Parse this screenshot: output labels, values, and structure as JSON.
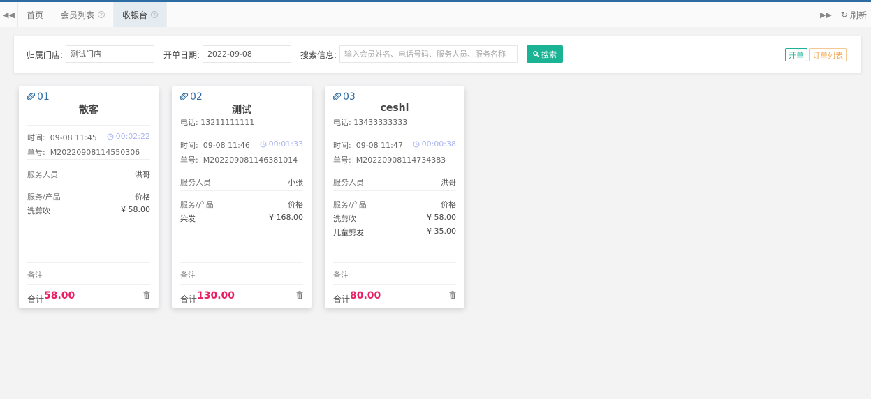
{
  "tabs": [
    {
      "label": "首页",
      "closable": false,
      "active": false
    },
    {
      "label": "会员列表",
      "closable": true,
      "active": false
    },
    {
      "label": "收银台",
      "closable": true,
      "active": true
    }
  ],
  "toolbar": {
    "refresh_label": "刷新"
  },
  "search": {
    "store_label": "归属门店:",
    "store_value": "测试门店",
    "date_label": "开单日期:",
    "date_value": "2022-09-08",
    "info_label": "搜索信息:",
    "info_placeholder": "输入会员姓名、电话号码、服务人员、服务名称",
    "search_button": "搜索",
    "open_button": "开单",
    "orders_button": "订单列表"
  },
  "labels": {
    "time": "时间:",
    "order_no": "单号:",
    "staff": "服务人员",
    "service": "服务/产品",
    "price": "价格",
    "remark": "备注",
    "total": "合计",
    "phone": "电话:"
  },
  "colors": {
    "accent": "#1ab394",
    "link": "#2d6ca2",
    "total": "#e91e63",
    "timer": "#aab4f0",
    "orders": "#f0a54b"
  },
  "cards": [
    {
      "no": "01",
      "name": "散客",
      "phone": "",
      "time": "09-08 11:45",
      "elapsed": "00:02:22",
      "order_no": "M20220908114550306",
      "staff": "洪哥",
      "items": [
        {
          "name": "洗剪吹",
          "price": "¥ 58.00"
        }
      ],
      "total": "58.00"
    },
    {
      "no": "02",
      "name": "测试",
      "phone": "13211111111",
      "time": "09-08 11:46",
      "elapsed": "00:01:33",
      "order_no": "M202209081146381014",
      "staff": "小张",
      "items": [
        {
          "name": "染发",
          "price": "¥ 168.00"
        }
      ],
      "total": "130.00"
    },
    {
      "no": "03",
      "name": "ceshi",
      "phone": "13433333333",
      "time": "09-08 11:47",
      "elapsed": "00:00:38",
      "order_no": "M20220908114734383",
      "staff": "洪哥",
      "items": [
        {
          "name": "洗剪吹",
          "price": "¥ 58.00"
        },
        {
          "name": "儿童剪发",
          "price": "¥ 35.00"
        }
      ],
      "total": "80.00"
    }
  ]
}
